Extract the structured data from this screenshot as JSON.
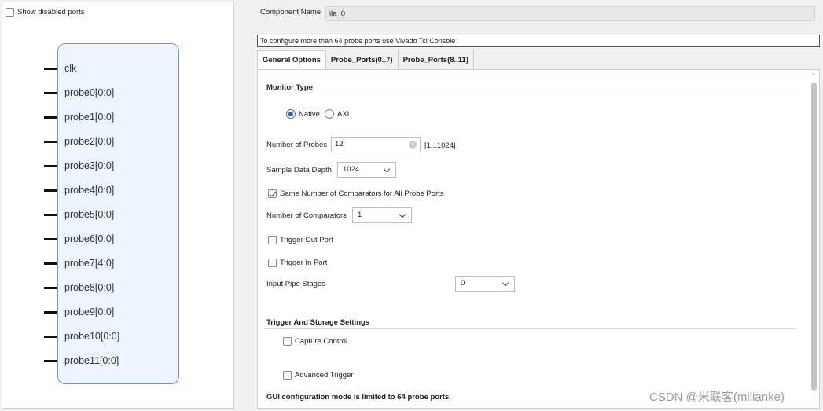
{
  "left": {
    "show_disabled_label": "Show disabled ports",
    "ports": [
      "clk",
      "probe0[0:0]",
      "probe1[0:0]",
      "probe2[0:0]",
      "probe3[0:0]",
      "probe4[0:0]",
      "probe5[0:0]",
      "probe6[0:0]",
      "probe7[4:0]",
      "probe8[0:0]",
      "probe9[0:0]",
      "probe10[0:0]",
      "probe11[0:0]"
    ]
  },
  "component": {
    "label": "Component Name",
    "value": "ila_0"
  },
  "info_bar": "To configure more than 64 probe ports use Vivado Tcl Console",
  "tabs": [
    "General Options",
    "Probe_Ports(0..7)",
    "Probe_Ports(8..11)"
  ],
  "general": {
    "monitor_type_title": "Monitor Type",
    "monitor_options": [
      "Native",
      "AXI"
    ],
    "num_probes_label": "Number of Probes",
    "num_probes_value": "12",
    "num_probes_range": "[1...1024]",
    "sample_depth_label": "Sample Data Depth",
    "sample_depth_value": "1024",
    "same_comparators_label": "Same Number of Comparators for All Probe Ports",
    "num_comparators_label": "Number of Comparators",
    "num_comparators_value": "1",
    "trigger_out_label": "Trigger Out Port",
    "trigger_in_label": "Trigger In Port",
    "pipe_stages_label": "Input Pipe Stages",
    "pipe_stages_value": "0",
    "trigger_storage_title": "Trigger And Storage Settings",
    "capture_control_label": "Capture Control",
    "advanced_trigger_label": "Advanced Trigger"
  },
  "footer_note": "GUI configuration mode is limited to 64 probe ports.",
  "watermark": "CSDN @米联客(milianke)"
}
